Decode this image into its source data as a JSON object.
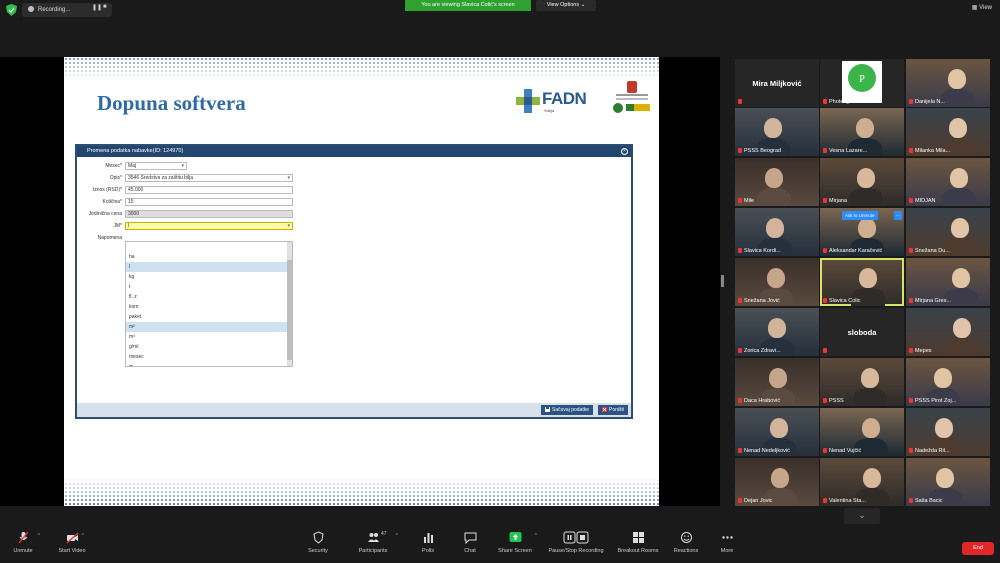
{
  "topbar": {
    "recording_label": "Recording...",
    "viewing_banner": "You are viewing Slavica Colić's screen",
    "view_options": "View Options",
    "view_label": "View"
  },
  "slide": {
    "title": "Dopuna softvera",
    "logo_text": "FADN",
    "logo_sub": "Srbija",
    "dialog": {
      "title": "Promena podatka nabavke(ID: 124970)",
      "fields": [
        {
          "label": "Mesec*",
          "value": "Maj"
        },
        {
          "label": "Opis*",
          "value": "3546 Sredstva za zaštitu bilja"
        },
        {
          "label": "Iznos (RSD)*",
          "value": "45.000"
        },
        {
          "label": "Količina*",
          "value": "15"
        },
        {
          "label": "Jedinična cena",
          "value": "3000"
        },
        {
          "label": "JM*",
          "value": "l"
        },
        {
          "label": "Napomena",
          "value": ""
        }
      ],
      "unit_options": [
        "",
        "ha",
        "l",
        "kg",
        "t",
        "fl. z",
        "kom",
        "paket",
        "m²",
        "m³",
        "g/ml",
        "mesec",
        "m"
      ],
      "unit_selected": "l",
      "save_button": "Sačuvaj podatke",
      "cancel_button": "Poništi"
    }
  },
  "gallery": {
    "tiles": [
      {
        "name": "Mira Miljković",
        "type": "name"
      },
      {
        "name": "Photesgroun",
        "type": "logo"
      },
      {
        "name": "Danijela N...",
        "type": "video"
      },
      {
        "name": "PSSS Beograd",
        "type": "video"
      },
      {
        "name": "Vesna Lazare...",
        "type": "video"
      },
      {
        "name": "Milanka Mila...",
        "type": "video"
      },
      {
        "name": "Mile",
        "type": "video"
      },
      {
        "name": "Mirjana",
        "type": "video"
      },
      {
        "name": "MIDJAN",
        "type": "video"
      },
      {
        "name": "Slavica Kordi...",
        "type": "video"
      },
      {
        "name": "Aleksandar Karačević",
        "type": "video"
      },
      {
        "name": "Snežana Du...",
        "type": "video"
      },
      {
        "name": "Snežana Jović",
        "type": "video"
      },
      {
        "name": "Slavica Colic",
        "type": "video"
      },
      {
        "name": "Mirjana Gres...",
        "type": "video"
      },
      {
        "name": "Zorica Zdravi...",
        "type": "video"
      },
      {
        "name": "sloboda",
        "type": "name"
      },
      {
        "name": "Mepes",
        "type": "video"
      },
      {
        "name": "Daca Hrabović",
        "type": "video"
      },
      {
        "name": "PSSS",
        "type": "video"
      },
      {
        "name": "PSSS Pirot Zoj...",
        "type": "video"
      },
      {
        "name": "Nenad Nedeljković",
        "type": "video"
      },
      {
        "name": "Nenad Vujčić",
        "type": "video"
      },
      {
        "name": "Nadežda Ril...",
        "type": "video"
      },
      {
        "name": "Dejan Jovic",
        "type": "video"
      },
      {
        "name": "Valentina Sta...",
        "type": "video"
      },
      {
        "name": "Saša Bacic",
        "type": "video"
      }
    ],
    "unmute_chip": "Ask to Unmute",
    "more_chip": "...",
    "more_arrow": "⌄"
  },
  "toolbar": {
    "unmute": "Unmute",
    "start_video": "Start Video",
    "security": "Security",
    "participants": "Participants",
    "participants_count": "47",
    "polls": "Polls",
    "chat": "Chat",
    "share_screen": "Share Screen",
    "pause_recording": "Pause/Stop Recording",
    "breakout_rooms": "Breakout Rooms",
    "reactions": "Reactions",
    "more": "More",
    "end": "End"
  },
  "colors": {
    "banner_green": "#30a030",
    "end_red": "#e02828",
    "slide_title_blue": "#2f6aa3",
    "dialog_header": "#23466e",
    "active_speaker": "#d6e36a"
  }
}
